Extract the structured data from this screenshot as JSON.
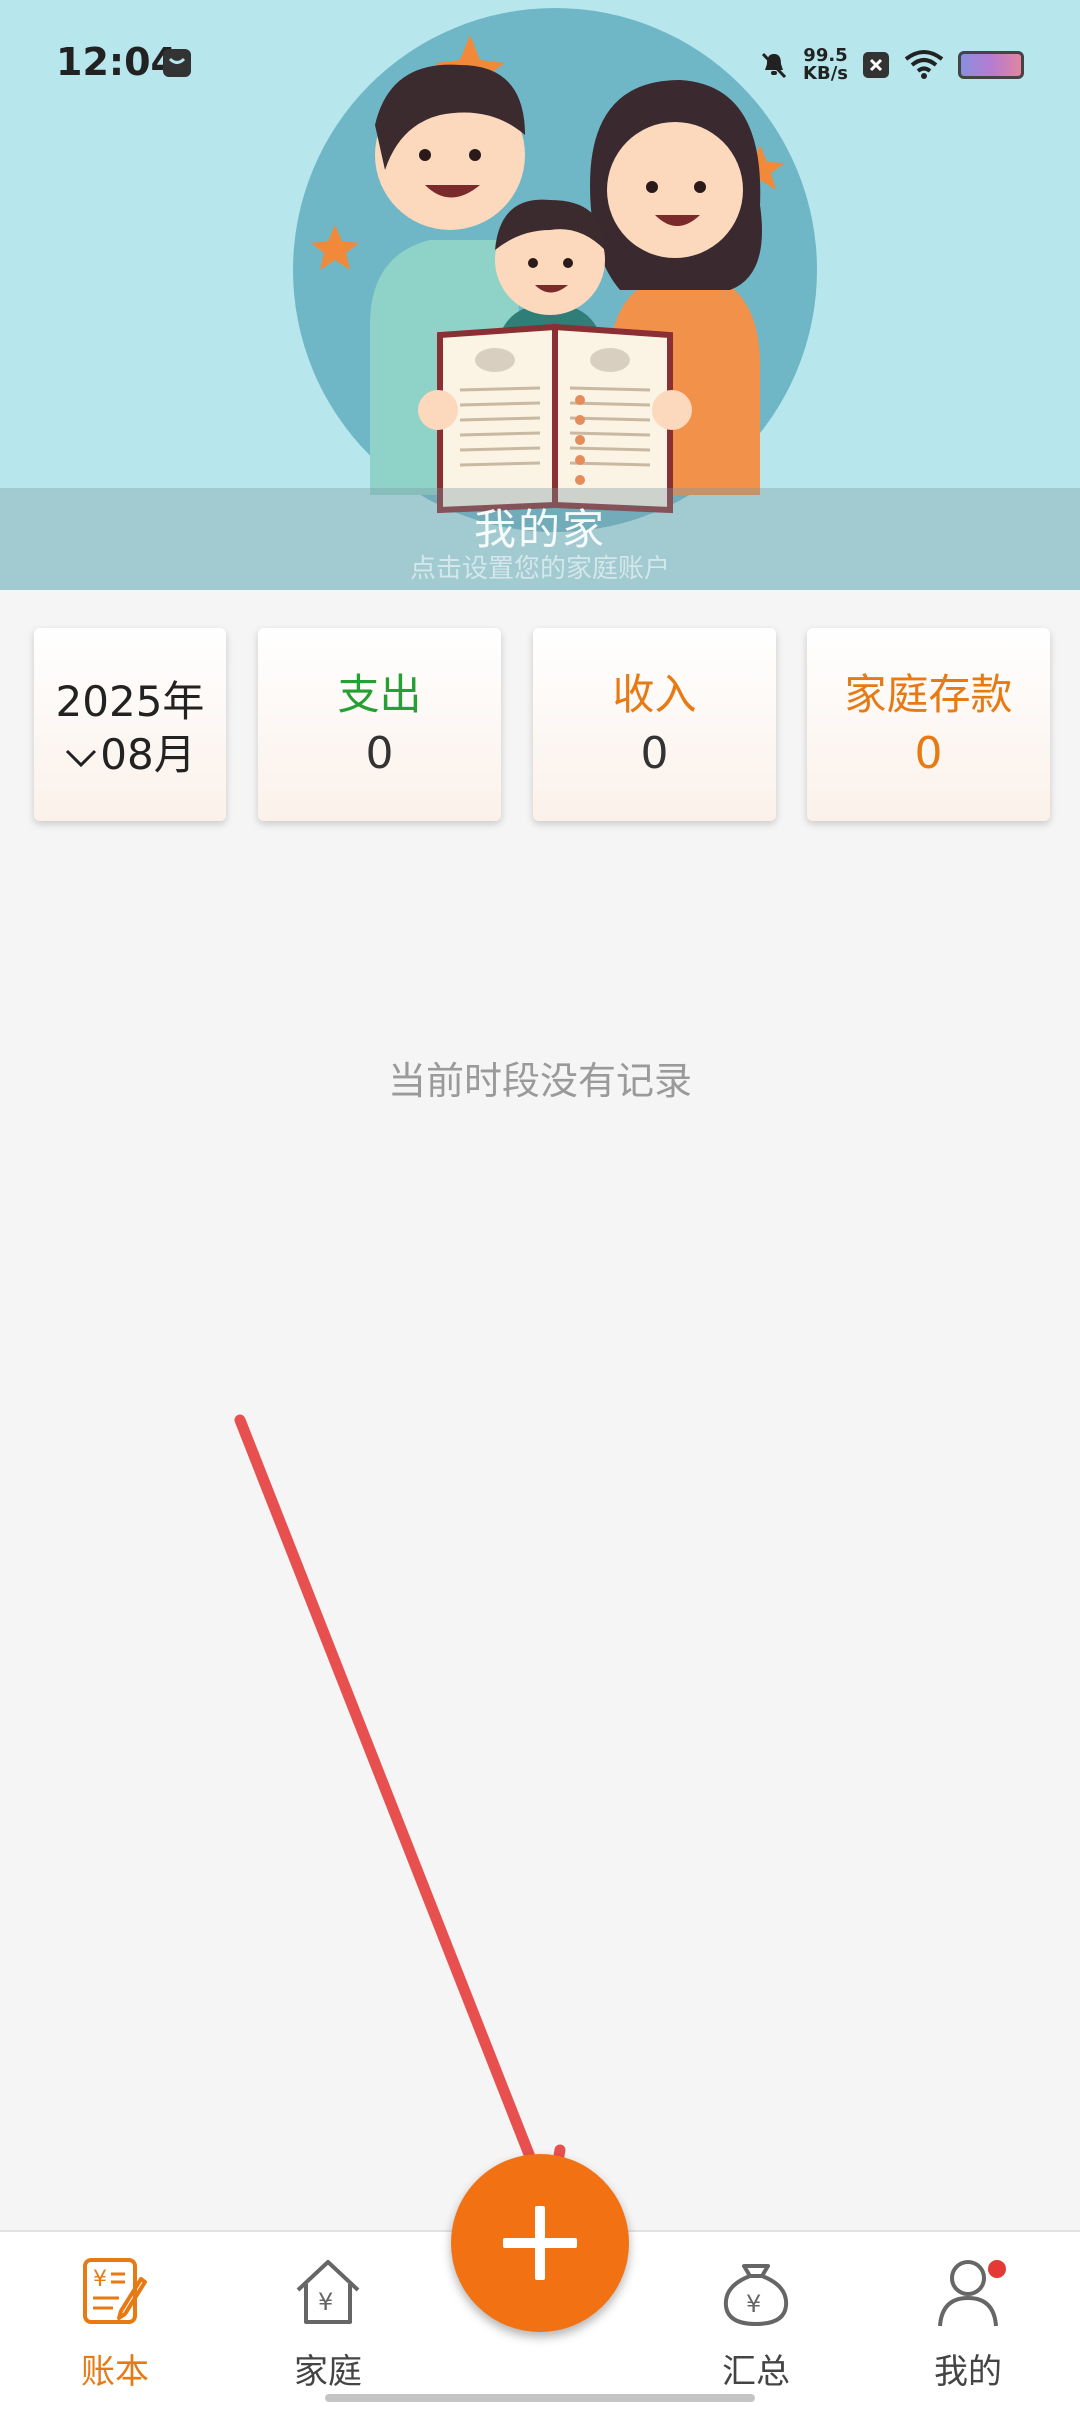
{
  "status_bar": {
    "time": "12:04",
    "net_speed_value": "99.5",
    "net_speed_unit": "KB/s",
    "icons": [
      "message-icon",
      "mute-icon",
      "close-box-icon",
      "wifi-icon",
      "battery-icon"
    ]
  },
  "header": {
    "family_name": "我的家",
    "hint": "点击设置您的家庭账户"
  },
  "summary": {
    "year": "2025年",
    "month": "08月",
    "expense_label": "支出",
    "expense_value": "0",
    "income_label": "收入",
    "income_value": "0",
    "savings_label": "家庭存款",
    "savings_value": "0"
  },
  "colors": {
    "accent": "#f27213",
    "expense": "#25a033",
    "income": "#e87a14",
    "header_bg": "#b7e6ec"
  },
  "empty_state": "当前时段没有记录",
  "bottom_nav": {
    "items": [
      {
        "label": "账本",
        "icon": "ledger-icon",
        "active": true
      },
      {
        "label": "家庭",
        "icon": "house-icon",
        "active": false
      },
      {
        "label": "汇总",
        "icon": "money-bag-icon",
        "active": false
      },
      {
        "label": "我的",
        "icon": "person-icon",
        "active": false
      }
    ],
    "fab_icon": "plus-icon"
  }
}
